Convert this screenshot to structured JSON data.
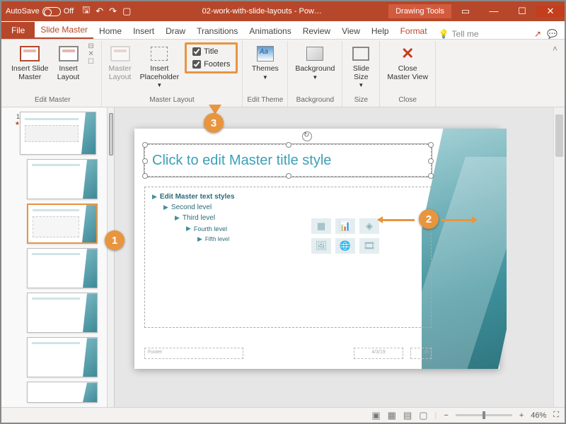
{
  "titlebar": {
    "autosave_label": "AutoSave",
    "autosave_state": "Off",
    "doc_title": "02-work-with-slide-layouts - Pow…",
    "contextual_label": "Drawing Tools"
  },
  "tabs": {
    "file": "File",
    "slidemaster": "Slide Master",
    "home": "Home",
    "insert": "Insert",
    "draw": "Draw",
    "transitions": "Transitions",
    "animations": "Animations",
    "review": "Review",
    "view": "View",
    "help": "Help",
    "format": "Format",
    "tellme": "Tell me"
  },
  "ribbon": {
    "edit_master": {
      "insert_slide_master": "Insert Slide\nMaster",
      "insert_layout": "Insert\nLayout",
      "group_label": "Edit Master"
    },
    "master_layout": {
      "master_layout_btn": "Master\nLayout",
      "insert_placeholder": "Insert\nPlaceholder",
      "title_chk": "Title",
      "footers_chk": "Footers",
      "group_label": "Master Layout"
    },
    "edit_theme": {
      "themes": "Themes",
      "group_label": "Edit Theme"
    },
    "background": {
      "background": "Background",
      "group_label": "Background"
    },
    "size": {
      "slide_size": "Slide\nSize",
      "group_label": "Size"
    },
    "close": {
      "close_master": "Close\nMaster View",
      "group_label": "Close"
    }
  },
  "callouts": {
    "c1": "1",
    "c2": "2",
    "c3": "3"
  },
  "slide": {
    "title_prompt": "Click to edit Master title style",
    "lvl1": "Edit Master text styles",
    "lvl2": "Second level",
    "lvl3": "Third level",
    "lvl4": "Fourth level",
    "lvl5": "Fifth level",
    "footer": "Footer",
    "date": "4/3/19",
    "num": "‹#›"
  },
  "status": {
    "zoom": "46%"
  },
  "thumbs": {
    "first_index": "1",
    "star": "★"
  }
}
